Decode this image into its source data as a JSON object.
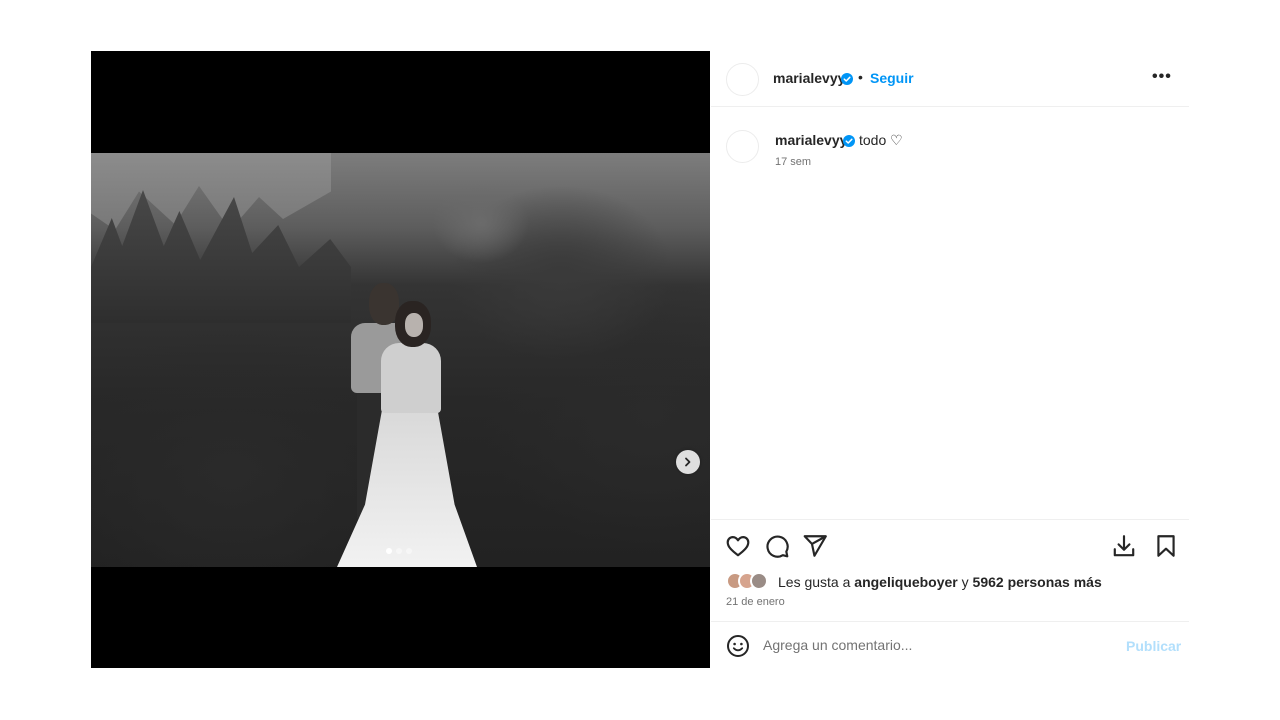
{
  "post": {
    "username": "marialevyy",
    "follow_label": "Seguir",
    "bullet": "•",
    "more_label": "•••",
    "caption": "todo ♡",
    "caption_time": "17 sem",
    "carousel": {
      "total": 3,
      "active_index": 0
    }
  },
  "engagement": {
    "likes_prefix": "Les gusta a ",
    "liker_name": "angeliqueboyer",
    "likes_joiner": " y ",
    "others_count": "5962 personas más",
    "date": "21 de enero"
  },
  "comment": {
    "placeholder": "Agrega un comentario...",
    "publish_label": "Publicar"
  },
  "icons": {
    "verified": "verified-badge-icon",
    "like": "heart-icon",
    "comment": "comment-bubble-icon",
    "share": "paper-plane-icon",
    "download": "download-icon",
    "save": "bookmark-icon",
    "emoji": "emoji-icon",
    "next": "chevron-right-icon"
  },
  "colors": {
    "accent": "#0095f6",
    "publish_disabled": "#b2dffc",
    "text": "#262626",
    "muted": "#737373",
    "divider": "#efefef",
    "media_bg": "#000000"
  }
}
